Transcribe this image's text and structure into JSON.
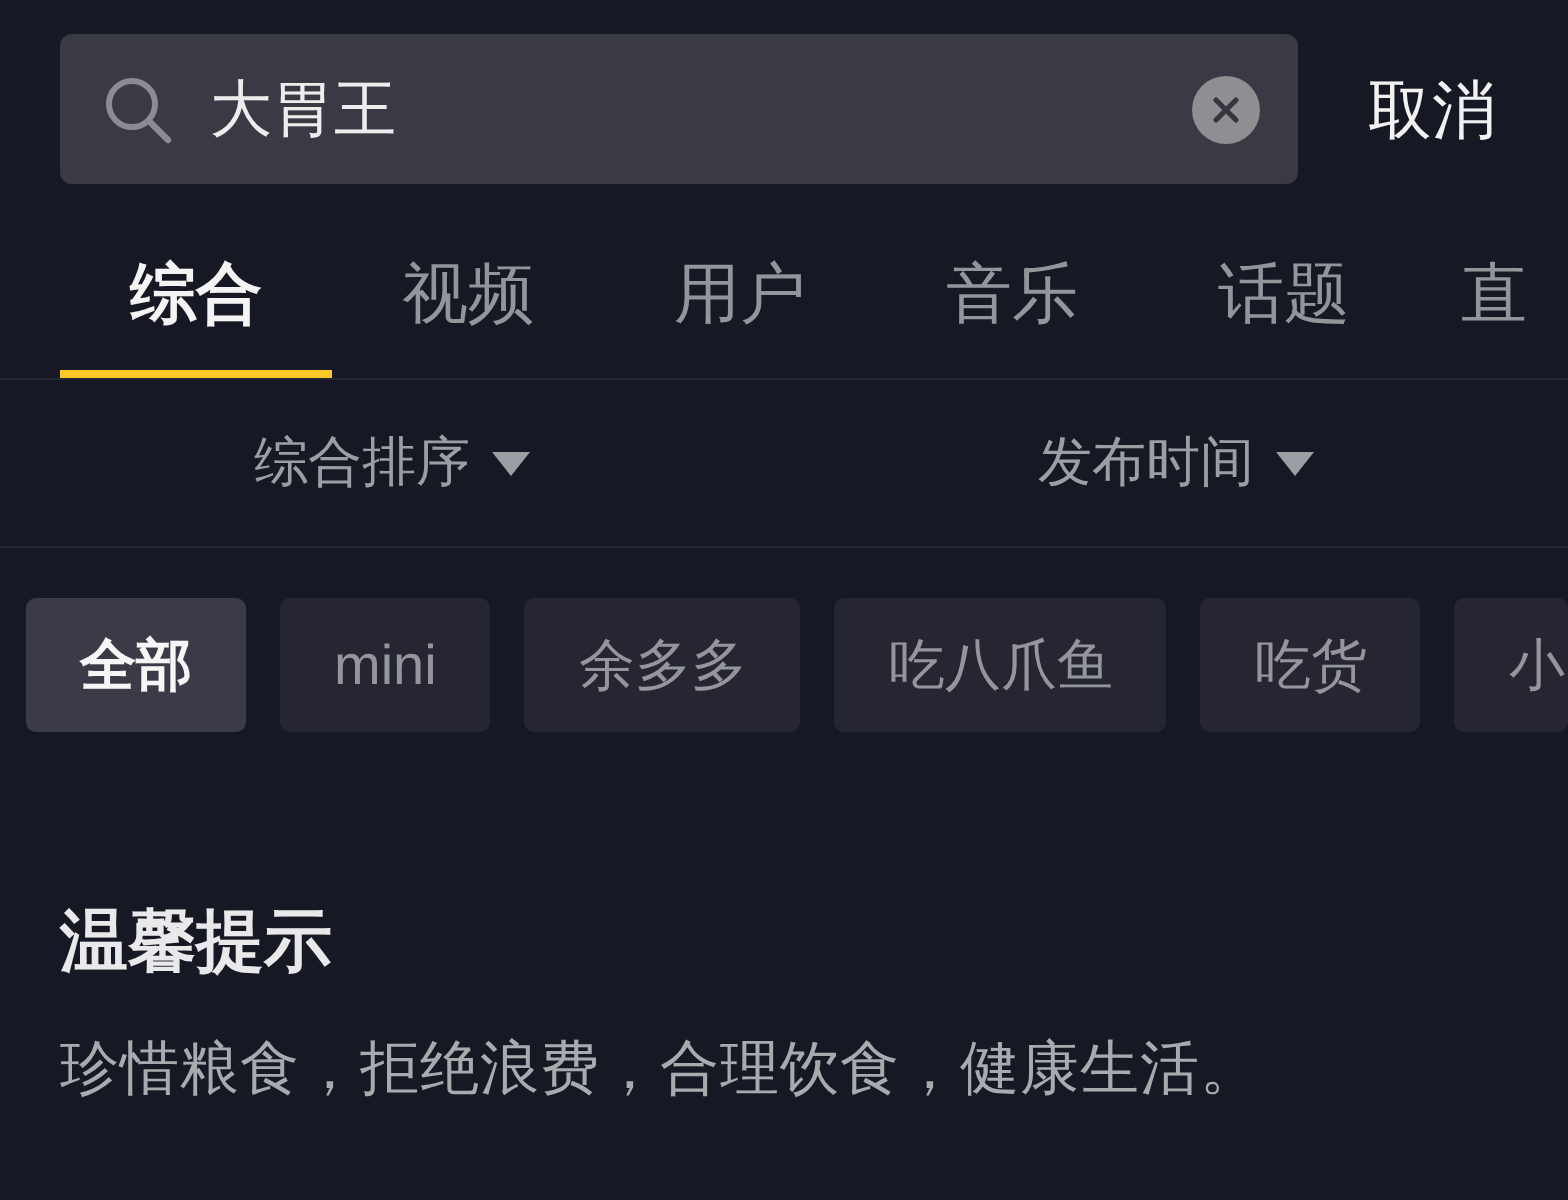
{
  "search": {
    "value": "大胃王",
    "cancel": "取消"
  },
  "tabs": [
    {
      "label": "综合",
      "selected": true
    },
    {
      "label": "视频",
      "selected": false
    },
    {
      "label": "用户",
      "selected": false
    },
    {
      "label": "音乐",
      "selected": false
    },
    {
      "label": "话题",
      "selected": false
    },
    {
      "label": "直",
      "selected": false
    }
  ],
  "sort_options": [
    {
      "label": "综合排序"
    },
    {
      "label": "发布时间"
    }
  ],
  "filter_chips": [
    {
      "label": "全部",
      "selected": true
    },
    {
      "label": "mini",
      "selected": false
    },
    {
      "label": "余多多",
      "selected": false
    },
    {
      "label": "吃八爪鱼",
      "selected": false
    },
    {
      "label": "吃货",
      "selected": false
    },
    {
      "label": "小",
      "selected": false
    }
  ],
  "notice": {
    "title": "温馨提示",
    "text": "珍惜粮食，拒绝浪费，合理饮食，健康生活。"
  }
}
